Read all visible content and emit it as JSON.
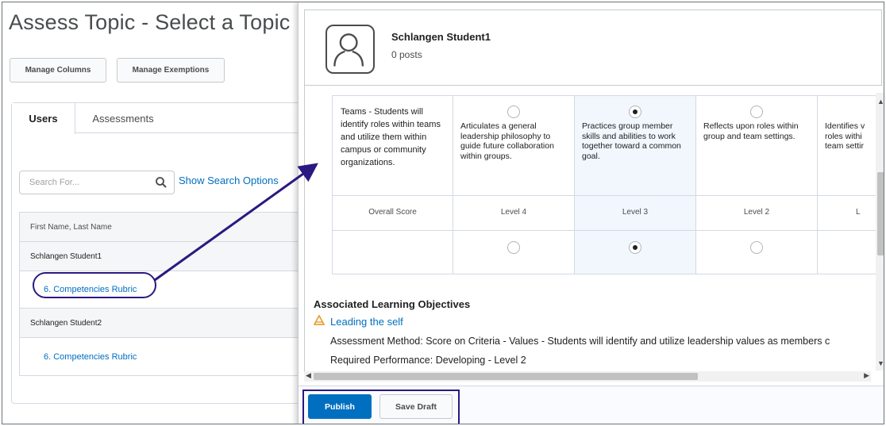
{
  "page": {
    "title": "Assess Topic - Select a Topic",
    "manage_columns": "Manage Columns",
    "manage_exemptions": "Manage Exemptions"
  },
  "tabs": [
    {
      "label": "Users",
      "active": true
    },
    {
      "label": "Assessments",
      "active": false
    }
  ],
  "search": {
    "placeholder": "Search For...",
    "options_link": "Show Search Options"
  },
  "grid": {
    "header": "First Name, Last Name",
    "rows": [
      {
        "student": "Schlangen Student1",
        "rubric": "6. Competencies Rubric"
      },
      {
        "student": "Schlangen Student2",
        "rubric": "6. Competencies Rubric"
      }
    ]
  },
  "dialog": {
    "student_name": "Schlangen Student1",
    "posts": "0 posts",
    "criterion": "Teams - Students will identify roles within teams and utilize them within campus or community organizations.",
    "levels": [
      {
        "label": "Level 4",
        "description": "Articulates a general leadership philosophy to guide future collaboration within groups.",
        "selected": false
      },
      {
        "label": "Level 3",
        "description": "Practices group member skills and abilities to work together toward a common goal.",
        "selected": true
      },
      {
        "label": "Level 2",
        "description": "Reflects upon roles within group and team settings.",
        "selected": false
      },
      {
        "label": "L",
        "description": "Identifies v roles withi team settir",
        "selected": false
      }
    ],
    "overall_score_label": "Overall Score",
    "objectives": {
      "title": "Associated Learning Objectives",
      "name": "Leading the self",
      "method": "Assessment Method:  Score on Criteria - Values - Students will identify and utilize leadership values as members c",
      "performance": "Required Performance:  Developing - Level 2"
    },
    "publish_label": "Publish",
    "save_draft_label": "Save Draft"
  },
  "colors": {
    "accent": "#006fbf",
    "annotation": "#2b1981",
    "selected_column": "#f1f7fd",
    "objective_icon": "#e8a33d"
  }
}
